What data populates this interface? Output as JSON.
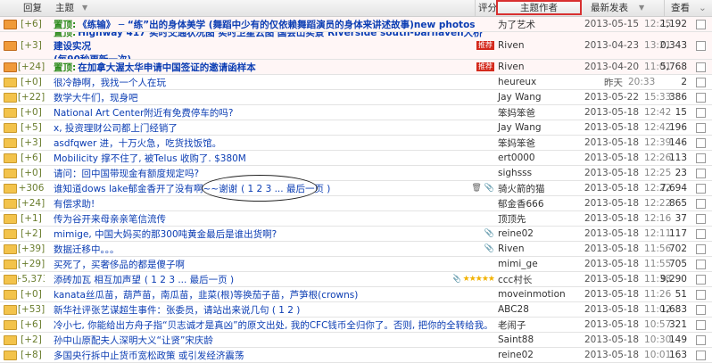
{
  "header": {
    "reply": "回复",
    "title": "主题",
    "rating": "评分",
    "author": "主题作者",
    "latest": "最新发表",
    "views": "查看"
  },
  "rows": [
    {
      "reply": "[+6]",
      "prefix": "置顶:",
      "title": "《练输》 ─ “练”出的身体美学 (舞蹈中少有的仅依赖舞蹈演员的身体来讲述故事)new photos",
      "author": "为了艺术",
      "date": "2013-05-15",
      "time": "12:25",
      "views": "1,192"
    },
    {
      "reply": "[+3]",
      "prefix": "置顶:",
      "title": "Highway 417 实时交通状况图 实时卫星云图 国会山实景 Riverside south-barhaven大桥建设实况",
      "title2": "(每90秒更新一次)",
      "tag": "推荐",
      "author": "Riven",
      "date": "2013-04-23",
      "time": "13:21",
      "views": "110,343"
    },
    {
      "reply": "[+24]",
      "prefix": "置顶:",
      "title": "在加拿大渥太华申请中国签证的邀请函样本",
      "tag": "推荐",
      "author": "Riven",
      "date": "2013-04-20",
      "time": "11:01",
      "views": "5,768"
    },
    {
      "reply": "[+0]",
      "title": "很冷静啊，我找一个人在玩",
      "author": "heureux",
      "date": "昨天",
      "time": "20:33",
      "views": "2"
    },
    {
      "reply": "[+22]",
      "title": "数学大牛们，现身吧",
      "author": "Jay Wang",
      "date": "2013-05-22",
      "time": "15:33",
      "views": "386"
    },
    {
      "reply": "[+0]",
      "title": "National Art Center附近有免费停车的吗?",
      "author": "笨妈笨爸",
      "date": "2013-05-18",
      "time": "12:42",
      "views": "15"
    },
    {
      "reply": "[+5]",
      "title": "x, 投资理财公司都上门经销了",
      "author": "Jay Wang",
      "date": "2013-05-18",
      "time": "12:42",
      "views": "196"
    },
    {
      "reply": "[+3]",
      "title": "asdfqwer 进，十万火急，吃货找饭馆。",
      "author": "笨妈笨爸",
      "date": "2013-05-18",
      "time": "12:39",
      "views": "146"
    },
    {
      "reply": "[+6]",
      "title": "Mobilicity 撑不住了, 被Telus 收购了. $380M",
      "author": "ert0000",
      "date": "2013-05-18",
      "time": "12:26",
      "views": "113"
    },
    {
      "reply": "[+0]",
      "title": "请问：回中国带现金有额度规定吗?",
      "author": "sighsss",
      "date": "2013-05-18",
      "time": "12:25",
      "views": "23"
    },
    {
      "reply": "[+306]",
      "title": "谁知道dows lake郁金香开了没有啊~~谢谢",
      "pages": "( 1 2 3 ... 最后一页 )",
      "author": "骑火箭的猫",
      "date": "2013-05-18",
      "time": "12:22",
      "views": "7,694"
    },
    {
      "reply": "[+24]",
      "title": "有偿求助!",
      "author": "郁金香666",
      "date": "2013-05-18",
      "time": "12:22",
      "views": "865"
    },
    {
      "reply": "[+1]",
      "title": "传为谷开来母亲亲笔信流传",
      "author": "顶顶先",
      "date": "2013-05-18",
      "time": "12:16",
      "views": "37"
    },
    {
      "reply": "[+2]",
      "title": "mimige, 中国大妈买的那300吨黄金最后是谁出货啊?",
      "author": "reine02",
      "date": "2013-05-18",
      "time": "12:11",
      "views": "117"
    },
    {
      "reply": "[+39]",
      "title": "数据迁移中。。。",
      "author": "Riven",
      "date": "2013-05-18",
      "time": "11:56",
      "views": "702"
    },
    {
      "reply": "[+29]",
      "title": "买死了，买奢侈品的都是傻子啊",
      "author": "mimi_ge",
      "date": "2013-05-18",
      "time": "11:55",
      "views": "705"
    },
    {
      "reply": "[+5,373]",
      "title": "添砖加瓦 相互加声望",
      "pages": "( 1 2 3 ... 最后一页 )",
      "author": "ccc村长",
      "date": "2013-05-18",
      "time": "11:38",
      "views": "79,290"
    },
    {
      "reply": "[+0]",
      "title": "kanata丝瓜苗，葫芦苗，南瓜苗，韭菜(根)等换茄子苗，芦笋根(crowns)",
      "author": "moveinmotion",
      "date": "2013-05-18",
      "time": "11:26",
      "views": "51"
    },
    {
      "reply": "[+53]",
      "title": "新华社评张艺谋超生事件：张委员，请站出来说几句 ( 1 2 )",
      "author": "ABC28",
      "date": "2013-05-18",
      "time": "11:02",
      "views": "1,683"
    },
    {
      "reply": "[+6]",
      "title": "冷小七, 你能给出方舟子指“贝志诚才是真凶”的原文出处, 我的CFC钱币全归你了。否则, 把你的全转给我。",
      "author": "老闹子",
      "date": "2013-05-18",
      "time": "10:57",
      "views": "321"
    },
    {
      "reply": "[+2]",
      "title": "孙中山原配夫人深明大义“让贤”宋庆龄",
      "author": "Saint88",
      "date": "2013-05-18",
      "time": "10:30",
      "views": "149"
    },
    {
      "reply": "[+8]",
      "title": "多国央行拆中止货币宽松政策 或引发经济震荡",
      "author": "reine02",
      "date": "2013-05-18",
      "time": "10:01",
      "views": "163"
    }
  ]
}
